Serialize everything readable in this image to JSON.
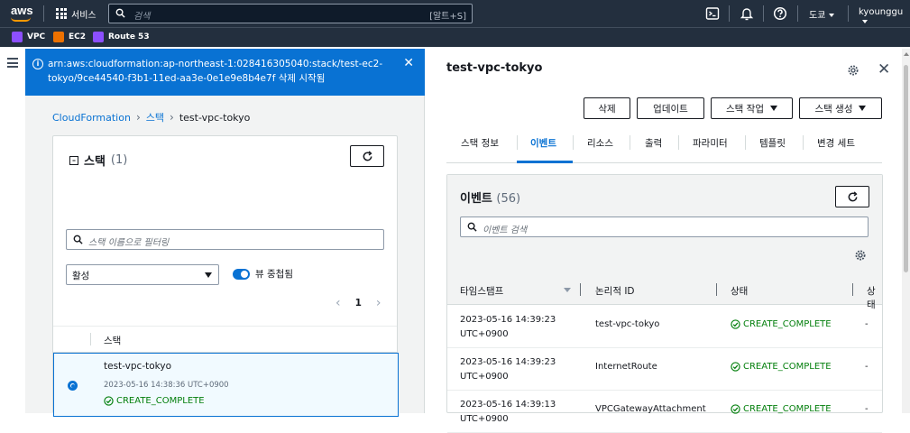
{
  "topbar": {
    "logo": "aws",
    "services_label": "서비스",
    "search_placeholder": "검색",
    "search_shortcut": "[알트+S]",
    "region_label": "도쿄",
    "user_label": "kyounggu",
    "icons": [
      "cloudshell-icon",
      "notifications-bell-icon",
      "help-icon"
    ]
  },
  "favorites": [
    {
      "label": "VPC",
      "color": "#8c4fff"
    },
    {
      "label": "EC2",
      "color": "#ed7100"
    },
    {
      "label": "Route 53",
      "color": "#8c4fff"
    }
  ],
  "flash": {
    "message": "arn:aws:cloudformation:ap-northeast-1:028416305040:stack/test-ec2-tokyo/9ce44540-f3b1-11ed-aa3e-0e1e9e8b4e7f 삭제 시작됨"
  },
  "breadcrumb": [
    "CloudFormation",
    "스택",
    "test-vpc-tokyo"
  ],
  "stacks_panel": {
    "title": "스택",
    "count": "(1)",
    "filter_placeholder": "스택 이름으로 필터링",
    "status_filter": "활성",
    "nested_toggle_label": "뷰 중첩됨",
    "page_number": "1",
    "column_header": "스택",
    "rows": [
      {
        "name": "test-vpc-tokyo",
        "time": "2023-05-16 14:38:36 UTC+0900",
        "status": "CREATE_COMPLETE"
      }
    ]
  },
  "detail": {
    "title": "test-vpc-tokyo",
    "buttons": {
      "delete": "삭제",
      "update": "업데이트",
      "stack_actions": "스택 작업",
      "create_stack": "스택 생성"
    },
    "tabs": [
      "스택 정보",
      "이벤트",
      "리소스",
      "출력",
      "파라미터",
      "템플릿",
      "변경 세트"
    ],
    "active_tab": "이벤트"
  },
  "events": {
    "title": "이벤트",
    "count": "(56)",
    "search_placeholder": "이벤트 검색",
    "columns": [
      "타임스탬프",
      "논리적 ID",
      "상태",
      "상태"
    ],
    "rows": [
      {
        "ts1": "2023-05-16 14:39:23",
        "ts2": "UTC+0900",
        "logical_id": "test-vpc-tokyo",
        "status": "CREATE_COMPLETE",
        "reason": "-"
      },
      {
        "ts1": "2023-05-16 14:39:23",
        "ts2": "UTC+0900",
        "logical_id": "InternetRoute",
        "status": "CREATE_COMPLETE",
        "reason": "-"
      },
      {
        "ts1": "2023-05-16 14:39:13",
        "ts2": "UTC+0900",
        "logical_id": "VPCGatewayAttachment",
        "status": "CREATE_COMPLETE",
        "reason": "-"
      }
    ]
  },
  "colors": {
    "nav_bg": "#232f3e",
    "accent": "#0972d3",
    "success": "#037f0c",
    "aws_orange": "#ff9900"
  }
}
